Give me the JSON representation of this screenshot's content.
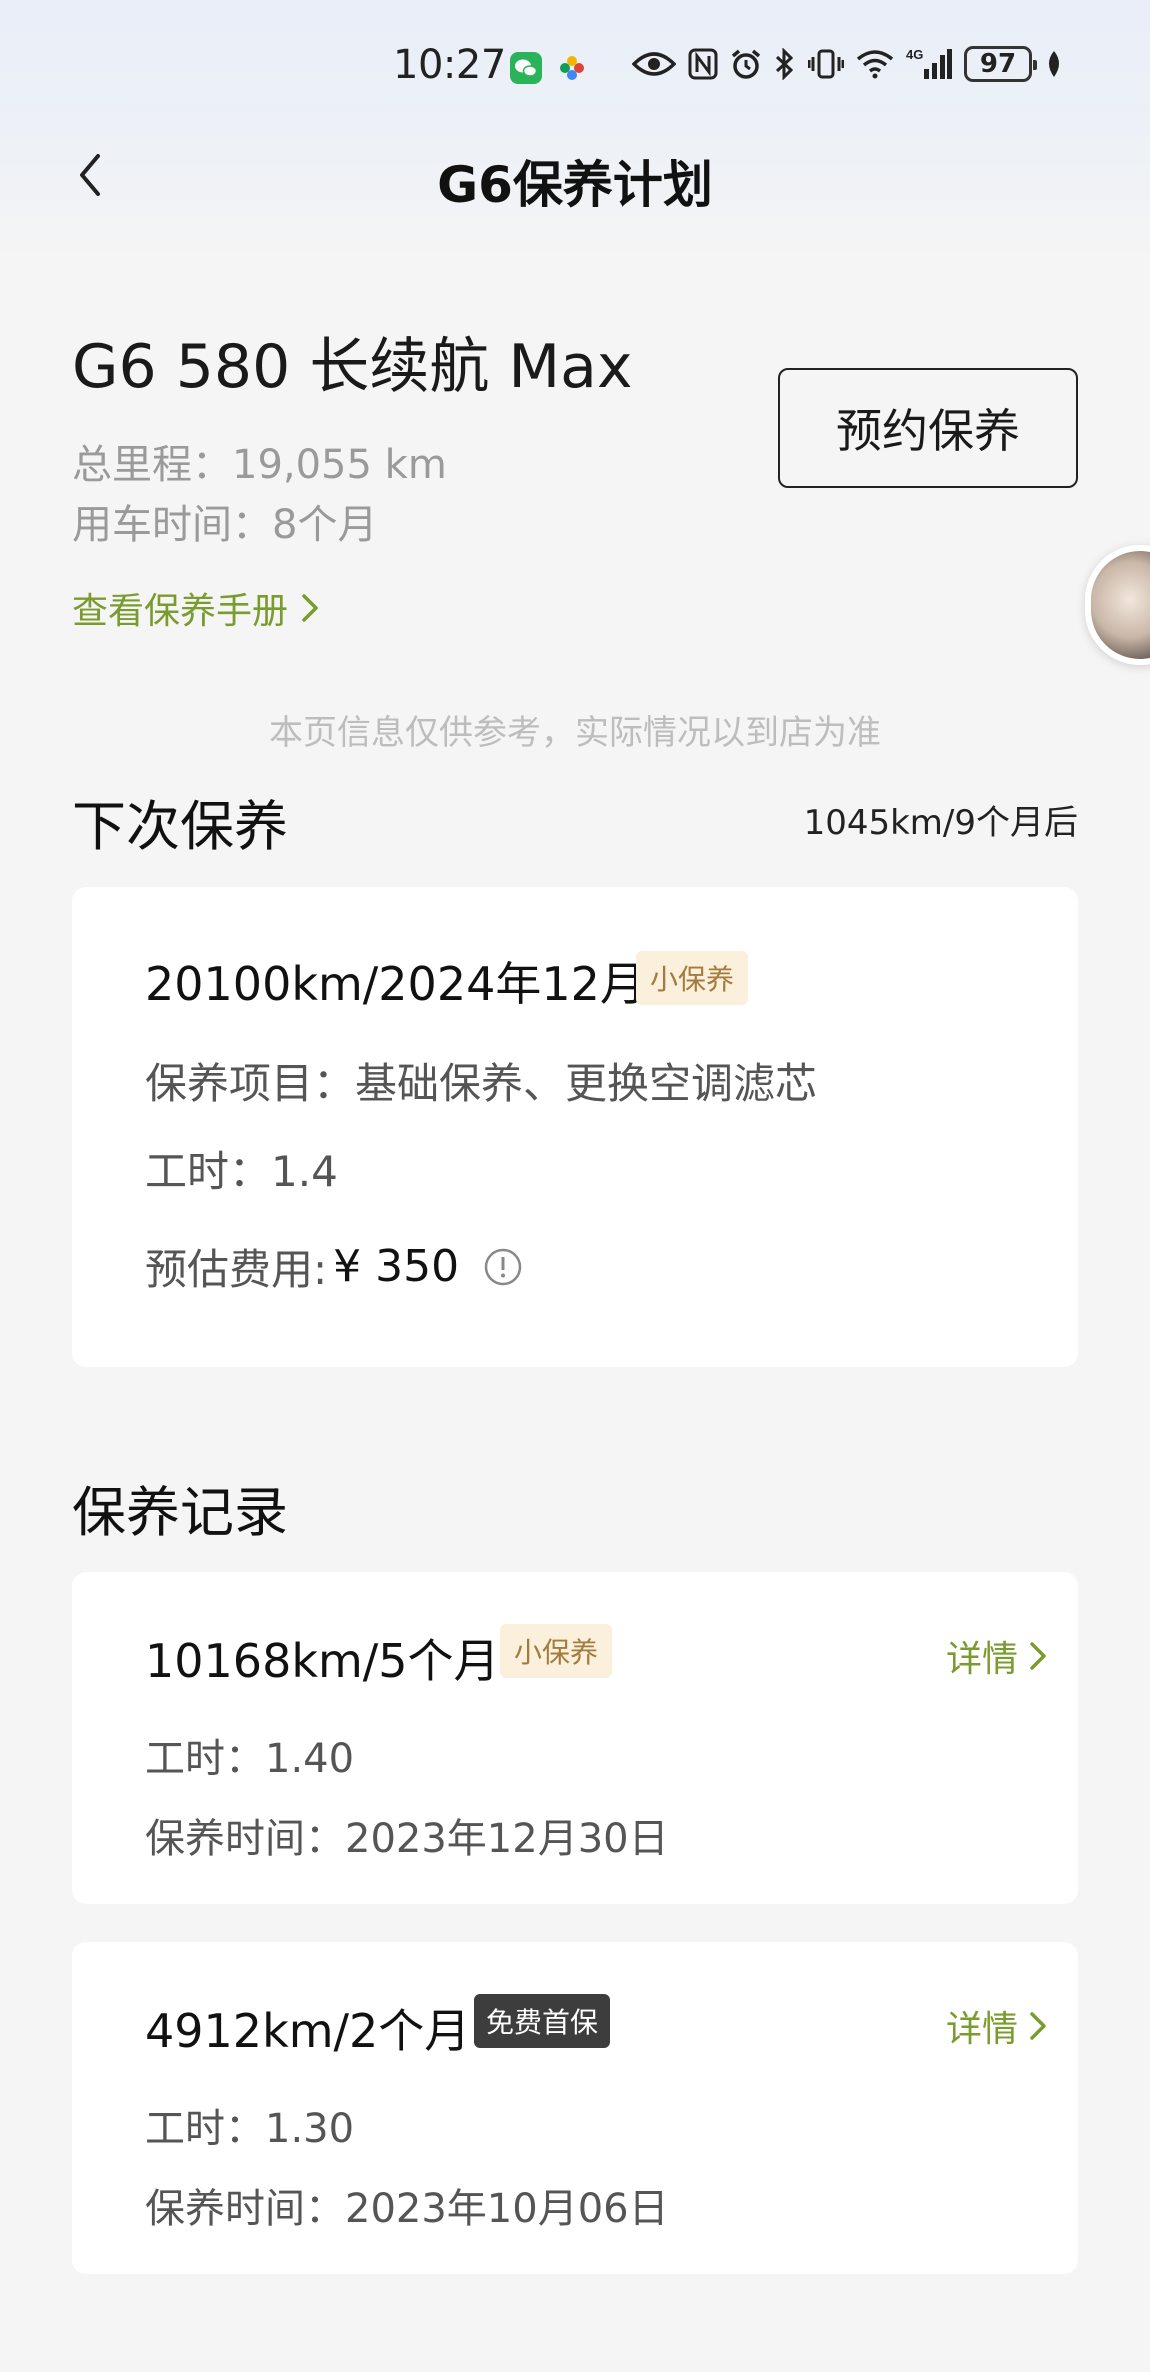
{
  "status_bar": {
    "time": "10:27",
    "battery": "97",
    "icons": [
      "wechat-icon",
      "photos-icon",
      "eye-icon",
      "nfc-icon",
      "alarm-icon",
      "bluetooth-icon",
      "vibrate-icon",
      "wifi-icon",
      "signal-4g-icon",
      "battery-icon",
      "leaf-icon"
    ]
  },
  "nav": {
    "title": "G6保养计划"
  },
  "vehicle": {
    "name": "G6 580 长续航 Max",
    "mileage": "总里程：19,055 km",
    "usage": "用车时间：8个月",
    "manual_link": "查看保养手册",
    "book_button": "预约保养"
  },
  "disclaimer": "本页信息仅供参考，实际情况以到店为准",
  "next_maintenance": {
    "title": "下次保养",
    "remaining": "1045km/9个月后",
    "km_date": "20100km/2024年12月",
    "tag": "小保养",
    "items": "保养项目：基础保养、更换空调滤芯",
    "hours": "工时：1.4",
    "cost_label": "预估费用:",
    "cost_value": "¥ 350"
  },
  "records": {
    "title": "保养记录",
    "detail_label": "详情",
    "items": [
      {
        "km_period": "10168km/5个月",
        "tag": "小保养",
        "hours": "工时：1.40",
        "date": "保养时间：2023年12月30日"
      },
      {
        "km_period": "4912km/2个月",
        "tag": "免费首保",
        "hours": "工时：1.30",
        "date": "保养时间：2023年10月06日"
      }
    ]
  },
  "colors": {
    "accent_green": "#7a9c2e",
    "tag_bg": "#fbf0dc",
    "tag_text": "#a47b3d",
    "tag_dark_bg": "#3d3d3d",
    "page_bg": "#f5f5f5"
  }
}
